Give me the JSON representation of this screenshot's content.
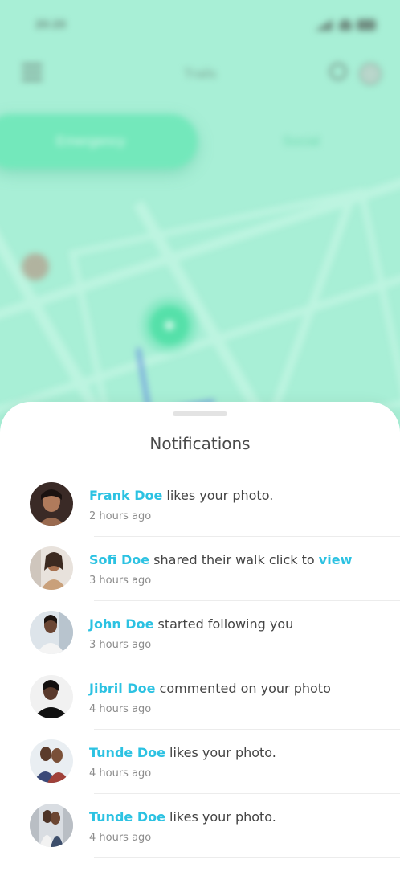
{
  "background_app": {
    "status_time": "20:20",
    "title": "Trails",
    "tabs": [
      {
        "label": "Emergency",
        "active": true
      },
      {
        "label": "Social",
        "active": false
      }
    ]
  },
  "sheet": {
    "title": "Notifications"
  },
  "notifications": [
    {
      "name": "Frank Doe",
      "action": " likes your photo.",
      "link": "",
      "time": "2 hours ago"
    },
    {
      "name": "Sofi Doe",
      "action": " shared their walk click to ",
      "link": "view",
      "time": "3 hours ago"
    },
    {
      "name": "John Doe",
      "action": " started following you",
      "link": "",
      "time": "3 hours ago"
    },
    {
      "name": "Jibril Doe",
      "action": " commented on your photo",
      "link": "",
      "time": "4 hours ago"
    },
    {
      "name": "Tunde Doe",
      "action": " likes your photo.",
      "link": "",
      "time": "4 hours ago"
    },
    {
      "name": "Tunde Doe",
      "action": " likes your photo.",
      "link": "",
      "time": "4 hours ago"
    }
  ],
  "colors": {
    "accent": "#2cc2e2",
    "background_mint": "#a8efd6",
    "tab_active": "#73e8bb"
  }
}
